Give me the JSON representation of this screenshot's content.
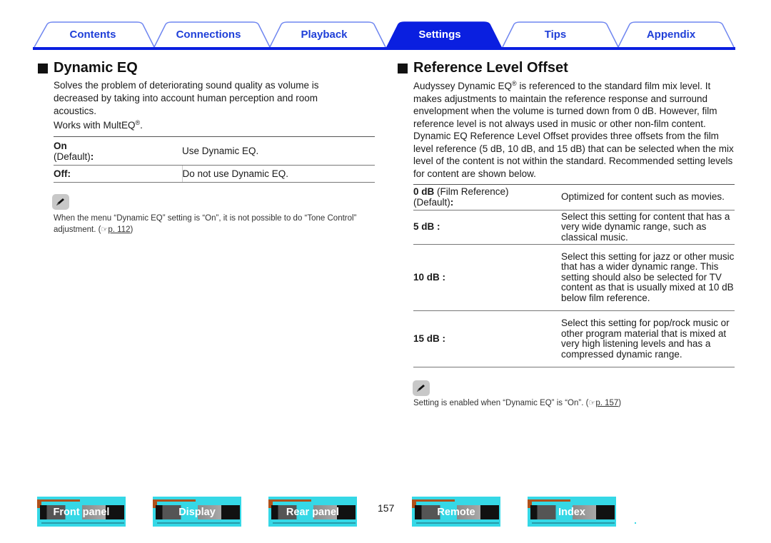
{
  "tabs": [
    {
      "label": "Contents",
      "active": false
    },
    {
      "label": "Connections",
      "active": false
    },
    {
      "label": "Playback",
      "active": false
    },
    {
      "label": "Settings",
      "active": true
    },
    {
      "label": "Tips",
      "active": false
    },
    {
      "label": "Appendix",
      "active": false
    }
  ],
  "colors": {
    "tab_text": "#1f3fd8",
    "tab_active_bg": "#0a1fe0",
    "nav_button_bg": "#35d8e6"
  },
  "dynamic_eq": {
    "title": "Dynamic EQ",
    "description": "Solves the problem of deteriorating sound quality as volume is decreased by taking into account human perception and room acoustics.",
    "works_with_prefix": "Works with MultEQ",
    "works_with_mark": "®",
    "works_with_suffix": ".",
    "options": [
      {
        "key_bold": "On",
        "key_normal": "(Default)",
        "key_suffix": ":",
        "value": "Use Dynamic EQ."
      },
      {
        "key_bold": "Off:",
        "key_normal": "",
        "key_suffix": "",
        "value": "Do not use Dynamic EQ."
      }
    ],
    "note_text": "When the menu “Dynamic EQ” setting is “On”, it is not possible to do “Tone Control” adjustment.",
    "note_ref_icon": "pointing-hand-icon",
    "note_ref": "p. 112"
  },
  "reference_level_offset": {
    "title": "Reference Level Offset",
    "description_prefix": "Audyssey Dynamic EQ",
    "description_mark": "®",
    "description_suffix": " is referenced to the standard film mix level. It makes adjustments to maintain the reference response and surround envelopment when the volume is turned down from 0 dB. However, film reference level is not always used in music or other non-film content. Dynamic EQ Reference Level Offset provides three offsets from the film level reference (5 dB, 10 dB, and 15 dB) that can be selected when the mix level of the content is not within the standard. Recommended setting levels for content are shown below.",
    "options": [
      {
        "key_bold": "0 dB",
        "key_normal": " (Film Reference)",
        "key_line2": "(Default)",
        "key_suffix": ":",
        "value": "Optimized for content such as movies."
      },
      {
        "key_bold": "5 dB :",
        "key_normal": "",
        "key_line2": "",
        "key_suffix": "",
        "value": "Select this setting for content that has a very wide dynamic range, such as classical music."
      },
      {
        "key_bold": "10 dB :",
        "key_normal": "",
        "key_line2": "",
        "key_suffix": "",
        "value": "Select this setting for jazz or other music that has a wider dynamic range. This setting should also be selected for TV content as that is usually mixed at 10 dB below film reference."
      },
      {
        "key_bold": "15 dB :",
        "key_normal": "",
        "key_line2": "",
        "key_suffix": "",
        "value": "Select this setting for pop/rock music or other program material that is mixed at very high listening levels and has a compressed dynamic range."
      }
    ],
    "note_text": "Setting is enabled when “Dynamic EQ” is “On”.",
    "note_ref_icon": "pointing-hand-icon",
    "note_ref": "p. 157"
  },
  "bottom_nav": [
    {
      "label": "Front panel"
    },
    {
      "label": "Display"
    },
    {
      "label": "Rear panel"
    },
    {
      "label": "Remote"
    },
    {
      "label": "Index"
    }
  ],
  "page_number": "157"
}
